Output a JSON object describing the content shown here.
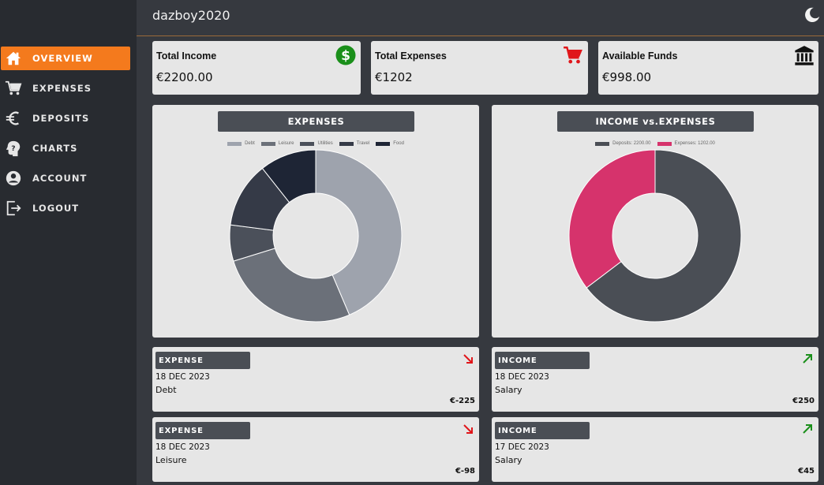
{
  "header": {
    "username": "dazboy2020"
  },
  "sidebar": {
    "items": [
      {
        "label": "OVERVIEW",
        "icon": "home-icon"
      },
      {
        "label": "EXPENSES",
        "icon": "cart-icon"
      },
      {
        "label": "DEPOSITS",
        "icon": "euro-icon"
      },
      {
        "label": "CHARTS",
        "icon": "help-head-icon"
      },
      {
        "label": "ACCOUNT",
        "icon": "account-icon"
      },
      {
        "label": "LOGOUT",
        "icon": "logout-icon"
      }
    ]
  },
  "stats": [
    {
      "title": "Total Income",
      "value": "€2200.00",
      "icon": "dollar-circle-icon"
    },
    {
      "title": "Total Expenses",
      "value": "€1202",
      "icon": "cart-icon"
    },
    {
      "title": "Available Funds",
      "value": "€998.00",
      "icon": "bank-icon"
    }
  ],
  "colors": {
    "accent": "#f47a1d",
    "income_green": "#1a8f1a",
    "expense_red": "#e0161a",
    "pink": "#d6336c",
    "dark_slice": "#4a4e55"
  },
  "chart_data": [
    {
      "type": "pie",
      "title": "EXPENSES",
      "categories": [
        "Debt",
        "Leisure",
        "Utilities",
        "Travel",
        "Food"
      ],
      "values": [
        545,
        333,
        85,
        154,
        133
      ],
      "colors": [
        "#9ea3ad",
        "#6b7079",
        "#4b505a",
        "#353a47",
        "#1e2535"
      ]
    },
    {
      "type": "pie",
      "title": "INCOME vs.EXPENSES",
      "categories": [
        "Deposits: 2200.00",
        "Expenses: 1202.00"
      ],
      "values": [
        2200,
        1202
      ],
      "colors": [
        "#4a4e55",
        "#d6336c"
      ]
    }
  ],
  "transactions": [
    {
      "type": "EXPENSE",
      "date": "18 DEC 2023",
      "category": "Debt",
      "amount": "€-225",
      "direction": "down"
    },
    {
      "type": "INCOME",
      "date": "18 DEC 2023",
      "category": "Salary",
      "amount": "€250",
      "direction": "up"
    },
    {
      "type": "EXPENSE",
      "date": "18 DEC 2023",
      "category": "Leisure",
      "amount": "€-98",
      "direction": "down"
    },
    {
      "type": "INCOME",
      "date": "17 DEC 2023",
      "category": "Salary",
      "amount": "€45",
      "direction": "up"
    }
  ]
}
